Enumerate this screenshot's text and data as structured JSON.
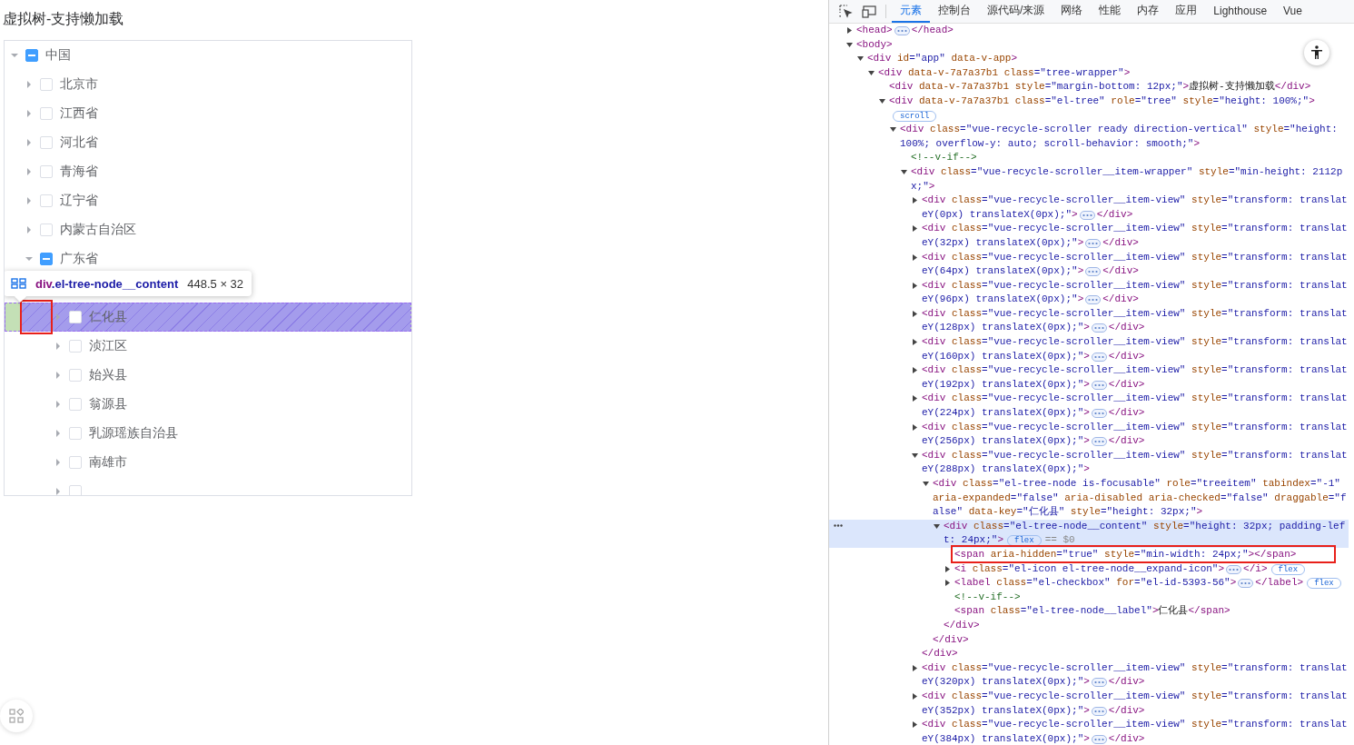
{
  "page": {
    "title": "虚拟树-支持懒加载",
    "tree": [
      {
        "label": "中国",
        "expanded": true,
        "checked": false,
        "indeterminate": true,
        "inspected": false,
        "children": [
          {
            "label": "北京市",
            "expanded": false,
            "checked": false,
            "indeterminate": false,
            "inspected": false
          },
          {
            "label": "江西省",
            "expanded": false,
            "checked": false,
            "indeterminate": false,
            "inspected": false
          },
          {
            "label": "河北省",
            "expanded": false,
            "checked": false,
            "indeterminate": false,
            "inspected": false
          },
          {
            "label": "青海省",
            "expanded": false,
            "checked": false,
            "indeterminate": false,
            "inspected": false
          },
          {
            "label": "辽宁省",
            "expanded": false,
            "checked": false,
            "indeterminate": false,
            "inspected": false
          },
          {
            "label": "内蒙古自治区",
            "expanded": false,
            "checked": false,
            "indeterminate": false,
            "inspected": false
          },
          {
            "label": "广东省",
            "expanded": true,
            "checked": false,
            "indeterminate": true,
            "inspected": false,
            "children": [
              {
                "label": "仁化县",
                "expanded": false,
                "checked": false,
                "indeterminate": false,
                "inspected": true
              },
              {
                "label": "浈江区",
                "expanded": false,
                "checked": false,
                "indeterminate": false,
                "inspected": false
              },
              {
                "label": "始兴县",
                "expanded": false,
                "checked": false,
                "indeterminate": false,
                "inspected": false
              },
              {
                "label": "翁源县",
                "expanded": false,
                "checked": false,
                "indeterminate": false,
                "inspected": false
              },
              {
                "label": "乳源瑶族自治县",
                "expanded": false,
                "checked": false,
                "indeterminate": false,
                "inspected": false
              },
              {
                "label": "南雄市",
                "expanded": false,
                "checked": false,
                "indeterminate": false,
                "inspected": false
              },
              {
                "expanded": false,
                "checked": false,
                "indeterminate": false,
                "inspected": false
              }
            ]
          }
        ]
      }
    ],
    "inspect_tooltip": {
      "selector": "div.el-tree-node__content",
      "size": "448.5 × 32"
    }
  },
  "devtools": {
    "tabs": [
      {
        "label": "元素",
        "selected": true
      },
      {
        "label": "控制台",
        "selected": false
      },
      {
        "label": "源代码/来源",
        "selected": false
      },
      {
        "label": "网络",
        "selected": false
      },
      {
        "label": "性能",
        "selected": false
      },
      {
        "label": "内存",
        "selected": false
      },
      {
        "label": "应用",
        "selected": false
      },
      {
        "label": "Lighthouse",
        "selected": false
      },
      {
        "label": "Vue",
        "selected": false
      }
    ],
    "dom": [
      {
        "open": "<head>",
        "expanded": false,
        "close": "</head>",
        "selected": false,
        "outlined": false
      },
      {
        "open": "<body>",
        "expanded": true,
        "selected": false,
        "outlined": false,
        "children": [
          {
            "open": "<div id=\"app\" data-v-app>",
            "expanded": true,
            "selected": false,
            "outlined": false,
            "children": [
              {
                "open": "<div data-v-7a7a37b1 class=\"tree-wrapper\">",
                "expanded": true,
                "selected": false,
                "outlined": false,
                "children": [
                  {
                    "open": "<div data-v-7a7a37b1 style=\"margin-bottom: 12px;\">虚拟树-支持懒加载</div>",
                    "selected": false,
                    "outlined": false
                  },
                  {
                    "open": "<div data-v-7a7a37b1 class=\"el-tree\" role=\"tree\" style=\"height: 100%;\">",
                    "expanded": true,
                    "badges": [
                      "scroll"
                    ],
                    "selected": false,
                    "outlined": false,
                    "children": [
                      {
                        "open": "<div class=\"vue-recycle-scroller ready direction-vertical\" style=\"height: 100%; overflow-y: auto; scroll-behavior: smooth;\">",
                        "expanded": true,
                        "selected": false,
                        "outlined": false,
                        "children": [
                          {
                            "open": "<!--v-if-->",
                            "selected": false,
                            "outlined": false
                          },
                          {
                            "open": "<div class=\"vue-recycle-scroller__item-wrapper\" style=\"min-height: 2112px;\">",
                            "expanded": true,
                            "selected": false,
                            "outlined": false,
                            "children": [
                              {
                                "open": "<div class=\"vue-recycle-scroller__item-view\" style=\"transform: translateY(0px) translateX(0px);\">",
                                "expanded": false,
                                "close": "</div>",
                                "selected": false,
                                "outlined": false
                              },
                              {
                                "open": "<div class=\"vue-recycle-scroller__item-view\" style=\"transform: translateY(32px) translateX(0px);\">",
                                "expanded": false,
                                "close": "</div>",
                                "selected": false,
                                "outlined": false
                              },
                              {
                                "open": "<div class=\"vue-recycle-scroller__item-view\" style=\"transform: translateY(64px) translateX(0px);\">",
                                "expanded": false,
                                "close": "</div>",
                                "selected": false,
                                "outlined": false
                              },
                              {
                                "open": "<div class=\"vue-recycle-scroller__item-view\" style=\"transform: translateY(96px) translateX(0px);\">",
                                "expanded": false,
                                "close": "</div>",
                                "selected": false,
                                "outlined": false
                              },
                              {
                                "open": "<div class=\"vue-recycle-scroller__item-view\" style=\"transform: translateY(128px) translateX(0px);\">",
                                "expanded": false,
                                "close": "</div>",
                                "selected": false,
                                "outlined": false
                              },
                              {
                                "open": "<div class=\"vue-recycle-scroller__item-view\" style=\"transform: translateY(160px) translateX(0px);\">",
                                "expanded": false,
                                "close": "</div>",
                                "selected": false,
                                "outlined": false
                              },
                              {
                                "open": "<div class=\"vue-recycle-scroller__item-view\" style=\"transform: translateY(192px) translateX(0px);\">",
                                "expanded": false,
                                "close": "</div>",
                                "selected": false,
                                "outlined": false
                              },
                              {
                                "open": "<div class=\"vue-recycle-scroller__item-view\" style=\"transform: translateY(224px) translateX(0px);\">",
                                "expanded": false,
                                "close": "</div>",
                                "selected": false,
                                "outlined": false
                              },
                              {
                                "open": "<div class=\"vue-recycle-scroller__item-view\" style=\"transform: translateY(256px) translateX(0px);\">",
                                "expanded": false,
                                "close": "</div>",
                                "selected": false,
                                "outlined": false
                              },
                              {
                                "open": "<div class=\"vue-recycle-scroller__item-view\" style=\"transform: translateY(288px) translateX(0px);\">",
                                "expanded": true,
                                "close": "</div>",
                                "selected": false,
                                "outlined": false,
                                "children": [
                                  {
                                    "open": "<div class=\"el-tree-node is-focusable\" role=\"treeitem\" tabindex=\"-1\" aria-expanded=\"false\" aria-disabled aria-checked=\"false\" draggable=\"false\" data-key=\"仁化县\" style=\"height: 32px;\">",
                                    "expanded": true,
                                    "close": "</div>",
                                    "selected": false,
                                    "outlined": false,
                                    "children": [
                                      {
                                        "open": "<div class=\"el-tree-node__content\" style=\"height: 32px; padding-left: 24px;\">",
                                        "expanded": true,
                                        "close": "</div>",
                                        "badges": [
                                          "flex"
                                        ],
                                        "note": "== $0",
                                        "selected": true,
                                        "outlined": false,
                                        "children": [
                                          {
                                            "open": "<span aria-hidden=\"true\" style=\"min-width: 24px;\"></span>",
                                            "selected": false,
                                            "outlined": true
                                          },
                                          {
                                            "open": "<i class=\"el-icon el-tree-node__expand-icon\">",
                                            "expanded": false,
                                            "close": "</i>",
                                            "badges": [
                                              "flex"
                                            ],
                                            "selected": false,
                                            "outlined": false
                                          },
                                          {
                                            "open": "<label class=\"el-checkbox\" for=\"el-id-5393-56\">",
                                            "expanded": false,
                                            "close": "</label>",
                                            "badges": [
                                              "flex"
                                            ],
                                            "selected": false,
                                            "outlined": false
                                          },
                                          {
                                            "open": "<!--v-if-->",
                                            "selected": false,
                                            "outlined": false
                                          },
                                          {
                                            "open": "<span class=\"el-tree-node__label\">仁化县</span>",
                                            "selected": false,
                                            "outlined": false
                                          }
                                        ]
                                      }
                                    ]
                                  }
                                ]
                              },
                              {
                                "open": "<div class=\"vue-recycle-scroller__item-view\" style=\"transform: translateY(320px) translateX(0px);\">",
                                "expanded": false,
                                "close": "</div>",
                                "selected": false,
                                "outlined": false
                              },
                              {
                                "open": "<div class=\"vue-recycle-scroller__item-view\" style=\"transform: translateY(352px) translateX(0px);\">",
                                "expanded": false,
                                "close": "</div>",
                                "selected": false,
                                "outlined": false
                              },
                              {
                                "open": "<div class=\"vue-recycle-scroller__item-view\" style=\"transform: translateY(384px) translateX(0px);\">",
                                "expanded": false,
                                "close": "</div>",
                                "selected": false,
                                "outlined": false
                              }
                            ]
                          }
                        ]
                      }
                    ]
                  }
                ]
              }
            ]
          }
        ]
      }
    ]
  }
}
